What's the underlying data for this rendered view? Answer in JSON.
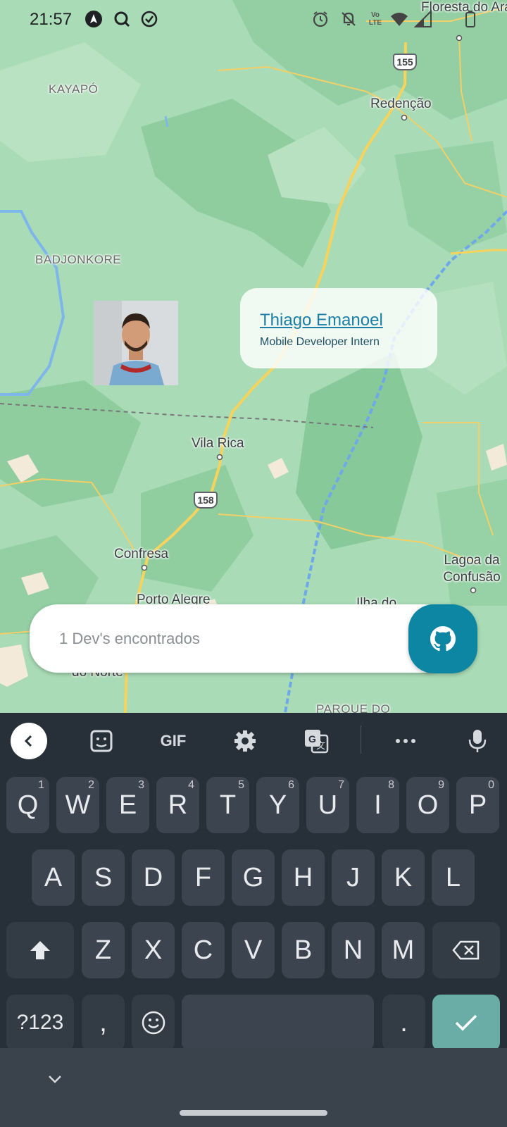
{
  "status_bar": {
    "time": "21:57",
    "left_icons": [
      "navigation-app-icon",
      "search-app-icon",
      "checklist-app-icon"
    ],
    "right_icons": [
      "alarm-icon",
      "notifications-off-icon",
      "volte-icon",
      "wifi-icon",
      "signal-icon",
      "battery-icon"
    ],
    "volte_text": "Vo LTE"
  },
  "map": {
    "labels": {
      "floresta": "Floresta do Araguaia",
      "kayapo": "KAYAPÓ",
      "redencao": "Redenção",
      "badjonkore": "BADJONKORE",
      "vila_rica": "Vila Rica",
      "confresa": "Confresa",
      "porto_alegre": "Porto Alegre",
      "do_norte": "do Norte",
      "lagoa": "Lagoa da Confusão",
      "ilha": "Ilha do",
      "parque": "PARQUE DO"
    },
    "shields": {
      "br155": "155",
      "br158": "158"
    }
  },
  "dev_marker": {
    "name": "Thiago Emanoel",
    "bio": "Mobile Developer Intern"
  },
  "search": {
    "text": "1 Dev's encontrados",
    "button_icon": "github-icon"
  },
  "keyboard": {
    "toolbar": {
      "back_icon": "chevron-left-icon",
      "sticker_icon": "sticker-icon",
      "gif_label": "GIF",
      "settings_icon": "gear-icon",
      "translate_icon": "translate-icon",
      "more_icon": "more-horiz-icon",
      "mic_icon": "microphone-icon"
    },
    "row1": [
      {
        "label": "Q",
        "hint": "1"
      },
      {
        "label": "W",
        "hint": "2"
      },
      {
        "label": "E",
        "hint": "3"
      },
      {
        "label": "R",
        "hint": "4"
      },
      {
        "label": "T",
        "hint": "5"
      },
      {
        "label": "Y",
        "hint": "6"
      },
      {
        "label": "U",
        "hint": "7"
      },
      {
        "label": "I",
        "hint": "8"
      },
      {
        "label": "O",
        "hint": "9"
      },
      {
        "label": "P",
        "hint": "0"
      }
    ],
    "row2": [
      "A",
      "S",
      "D",
      "F",
      "G",
      "H",
      "J",
      "K",
      "L"
    ],
    "row3": [
      "Z",
      "X",
      "C",
      "V",
      "B",
      "N",
      "M"
    ],
    "symbols_label": "?123",
    "comma_label": ",",
    "period_label": ".",
    "shift_icon": "shift-icon",
    "backspace_icon": "backspace-icon",
    "emoji_icon": "emoji-icon",
    "enter_icon": "checkmark-icon",
    "hide_icon": "chevron-down-icon"
  },
  "colors": {
    "accent": "#0c86a3",
    "link": "#1b7fa6",
    "enter_key": "#6aada7"
  }
}
